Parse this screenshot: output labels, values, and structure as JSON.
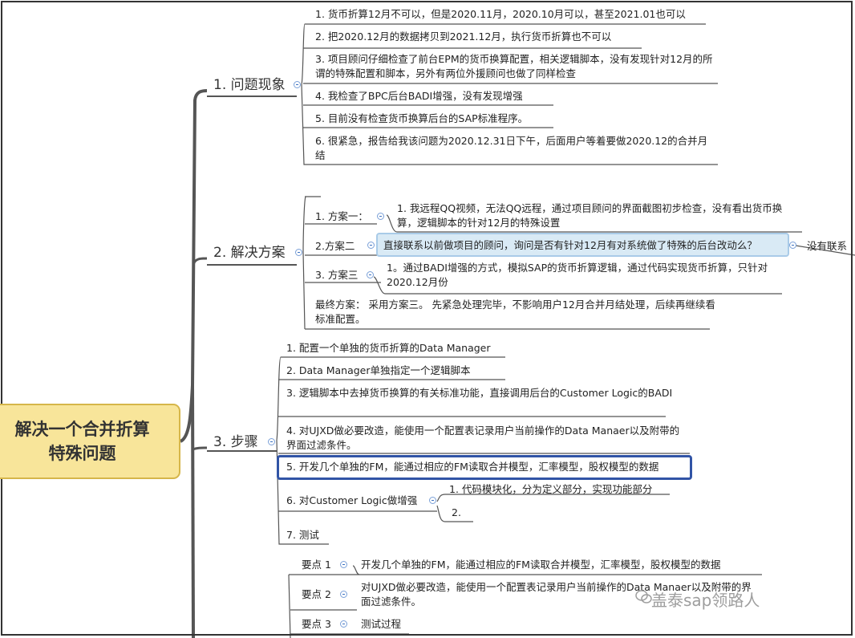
{
  "root": {
    "line1": "解决一个合并折算",
    "line2": "特殊问题"
  },
  "branches": [
    {
      "label": "1. 问题现象",
      "items": [
        "1. 货币折算12月不可以，但是2020.11月，2020.10月可以，甚至2021.01也可以",
        "2. 把2020.12月的数据拷贝到2021.12月，执行货币折算也不可以",
        "3. 项目顾问仔细检查了前台EPM的货币换算配置，相关逻辑脚本，没有发现针对12月的所谓的特殊配置和脚本，另外有两位外援顾问也做了同样检查",
        "4. 我检查了BPC后台BADI增强，没有发现增强",
        "5. 目前没有检查货币换算后台的SAP标准程序。",
        "6. 很紧急，报告给我该问题为2020.12.31日下午，后面用户等着要做2020.12的合并月结"
      ]
    },
    {
      "label": "2. 解决方案",
      "plans": [
        {
          "label": "1. 方案一：",
          "detail": "1. 我远程QQ视频，无法QQ远程，通过项目顾问的界面截图初步检查，没有看出货币换算，逻辑脚本的针对12月的特殊设置"
        },
        {
          "label": "2.方案二",
          "detail": "直接联系以前做项目的顾问，询问是否有针对12月有对系统做了特殊的后台改动么？",
          "result": "没有联系"
        },
        {
          "label": "3. 方案三",
          "detail": "1。通过BADI增强的方式，模拟SAP的货币折算逻辑，通过代码实现货币折算，只针对2020.12月份"
        }
      ],
      "final": "最终方案： 采用方案三。 先紧急处理完毕，不影响用户12月合并月结处理，后续再继续看标准配置。"
    },
    {
      "label": "3. 步骤",
      "items": [
        "1. 配置一个单独的货币折算的Data Manager",
        "2. Data Manager单独指定一个逻辑脚本",
        "3. 逻辑脚本中去掉货币换算的有关标准功能，直接调用后台的Customer Logic的BADI",
        "4. 对UJXD做必要改造，能使用一个配置表记录用户当前操作的Data Manaer以及附带的界面过滤条件。",
        "5. 开发几个单独的FM，能通过相应的FM读取合并模型，汇率模型，股权模型的数据",
        "6. 对Customer Logic做增强",
        "7. 测试"
      ],
      "sub6": [
        "1. 代码模块化，分为定义部分，实现功能部分",
        "2."
      ]
    },
    {
      "points": [
        {
          "label": "要点 1",
          "text": "开发几个单独的FM，能通过相应的FM读取合并模型，汇率模型，股权模型的数据"
        },
        {
          "label": "要点 2",
          "text": "对UJXD做必要改造，能使用一个配置表记录用户当前操作的Data Manaer以及附带的界面过滤条件。"
        },
        {
          "label": "要点 3",
          "text": "测试过程"
        }
      ]
    }
  ],
  "watermark": "盖泰sap领路人",
  "colors": {
    "root_fill": "#f8e59a",
    "root_border": "#d6b64a",
    "highlight_fill": "#d9eaf5",
    "selected_border": "#3154a6"
  }
}
